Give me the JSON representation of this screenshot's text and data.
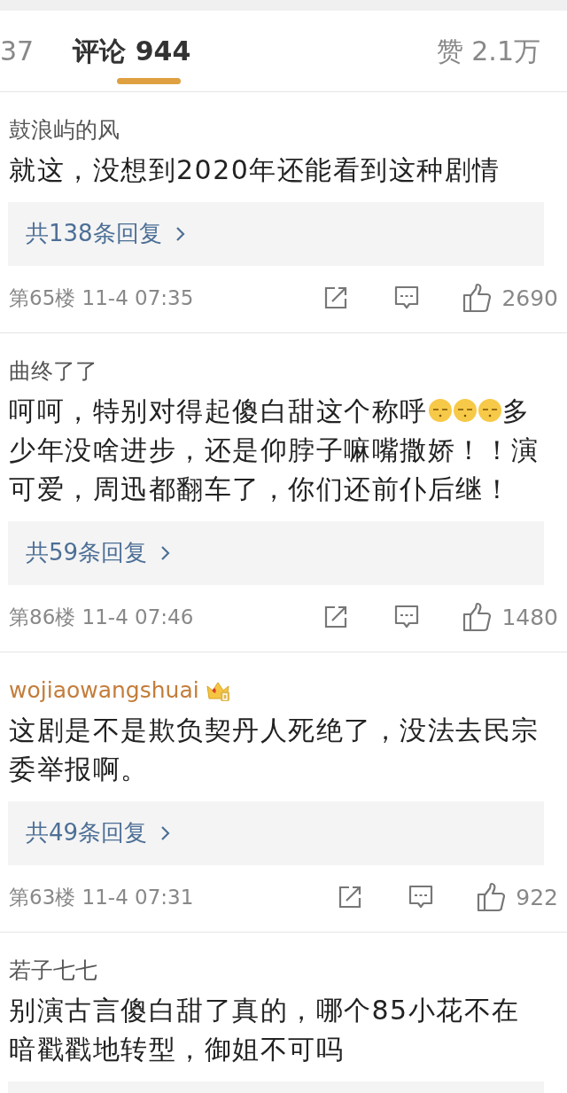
{
  "tabs": [
    {
      "label": "37",
      "selected": false
    },
    {
      "label": "评论 944",
      "selected": true
    }
  ],
  "likes_tab": {
    "label": "赞 2.1万",
    "selected": false
  },
  "comments": [
    {
      "user": "鼓浪屿的风",
      "vip": false,
      "segments": [
        {
          "kind": "text",
          "text": "就这，没想到2020年还能看到这种剧情"
        }
      ],
      "replies": "共138条回复",
      "floor": "第65楼",
      "time": "11-4 07:35",
      "likes": "2690"
    },
    {
      "user": "曲终了了",
      "vip": false,
      "segments": [
        {
          "kind": "text",
          "text": "呵呵，特别对得起傻白甜这个称呼"
        },
        {
          "kind": "emoji"
        },
        {
          "kind": "emoji"
        },
        {
          "kind": "emoji"
        },
        {
          "kind": "text",
          "text": "多少年没啥进步，还是仰脖子嘛嘴撒娇！！演可爱，周迅都翻车了，你们还前仆后继！"
        }
      ],
      "replies": "共59条回复",
      "floor": "第86楼",
      "time": "11-4 07:46",
      "likes": "1480"
    },
    {
      "user": "wojiaowangshuai",
      "vip": true,
      "segments": [
        {
          "kind": "text",
          "text": "这剧是不是欺负契丹人死绝了，没法去民宗委举报啊。"
        }
      ],
      "replies": "共49条回复",
      "floor": "第63楼",
      "time": "11-4 07:31",
      "likes": "922"
    },
    {
      "user": "若子七七",
      "vip": false,
      "segments": [
        {
          "kind": "text",
          "text": "别演古言傻白甜了真的，哪个85小花不在暗戳戳地转型，御姐不可吗"
        }
      ],
      "reply_box_cut": true
    }
  ]
}
